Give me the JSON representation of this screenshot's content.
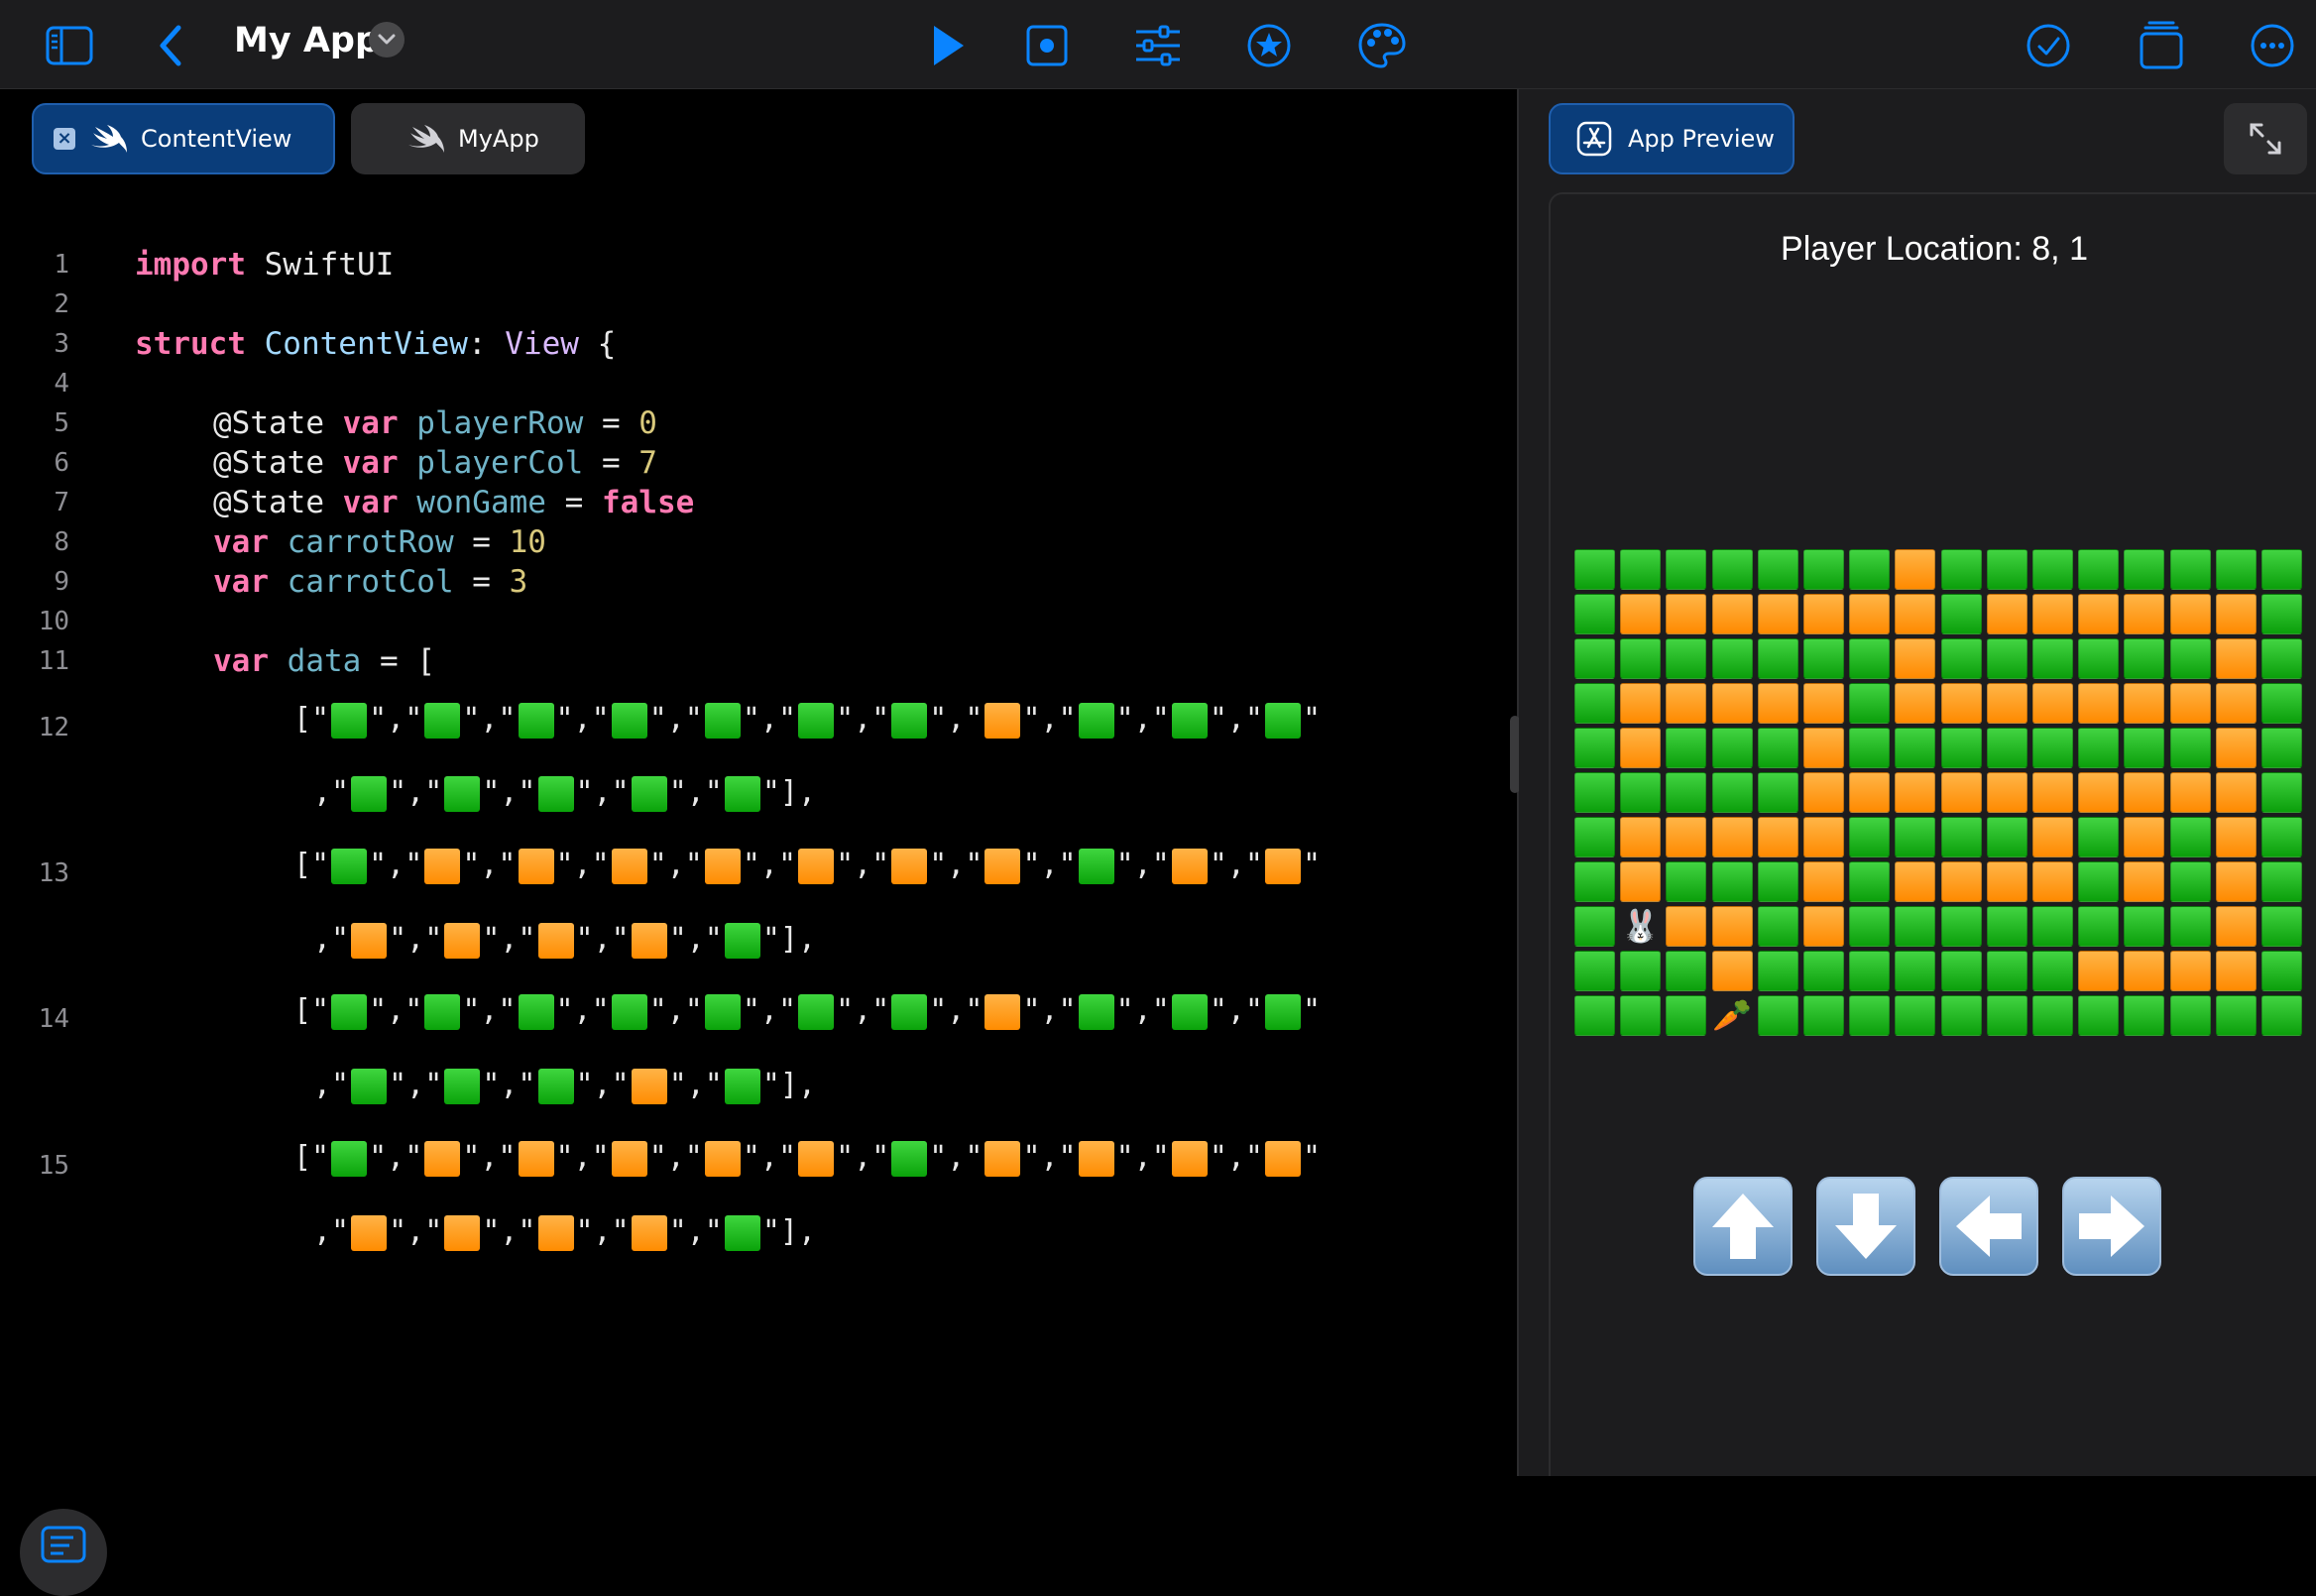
{
  "toolbar": {
    "title": "My App",
    "icons": [
      "sidebar-toggle-icon",
      "back-chevron-icon",
      "run-play-icon",
      "stop-record-icon",
      "sliders-icon",
      "star-circle-icon",
      "palette-icon",
      "checkmark-circle-icon",
      "stacked-windows-icon",
      "ellipsis-circle-icon"
    ]
  },
  "colors": {
    "accent": "#0a84ff",
    "tab_selected": "#0a3d7a",
    "emoji_green": "#1db41d",
    "emoji_orange": "#ff9500"
  },
  "editor": {
    "tabs": [
      {
        "label": "ContentView",
        "selected": true
      },
      {
        "label": "MyApp",
        "selected": false
      }
    ],
    "line_numbers": [
      "1",
      "2",
      "3",
      "4",
      "5",
      "6",
      "7",
      "8",
      "9",
      "10",
      "11",
      "12",
      "13",
      "14",
      "15"
    ],
    "code": {
      "l1_kw": "import",
      "l1_rest": " SwiftUI",
      "l3_kw": "struct",
      "l3_name": " ContentView",
      "l3_colon": ": ",
      "l3_type": "View",
      "l3_brace": " {",
      "l5_attr": "@State",
      "l5_var": " var",
      "l5_id": " playerRow",
      "l5_eq": " = ",
      "l5_val": "0",
      "l6_attr": "@State",
      "l6_var": " var",
      "l6_id": " playerCol",
      "l6_eq": " = ",
      "l6_val": "7",
      "l7_attr": "@State",
      "l7_var": " var",
      "l7_id": " wonGame",
      "l7_eq": " = ",
      "l7_val": "false",
      "l8_var": "var",
      "l8_id": " carrotRow",
      "l8_eq": " = ",
      "l8_val": "10",
      "l9_var": "var",
      "l9_id": " carrotCol",
      "l9_eq": " = ",
      "l9_val": "3",
      "l11_var": "var",
      "l11_id": " data",
      "l11_eq": " = ["
    },
    "array_rows": [
      [
        "g",
        "g",
        "g",
        "g",
        "g",
        "g",
        "g",
        "o",
        "g",
        "g",
        "g",
        "g",
        "g",
        "g",
        "g",
        "g"
      ],
      [
        "g",
        "o",
        "o",
        "o",
        "o",
        "o",
        "o",
        "o",
        "g",
        "o",
        "o",
        "o",
        "o",
        "o",
        "o",
        "g"
      ],
      [
        "g",
        "g",
        "g",
        "g",
        "g",
        "g",
        "g",
        "o",
        "g",
        "g",
        "g",
        "g",
        "g",
        "g",
        "o",
        "g"
      ],
      [
        "g",
        "o",
        "o",
        "o",
        "o",
        "o",
        "g",
        "o",
        "o",
        "o",
        "o",
        "o",
        "o",
        "o",
        "o",
        "g"
      ]
    ]
  },
  "preview": {
    "tab_label": "App Preview",
    "player_location": "Player Location: 8, 1",
    "bunny": "🐰",
    "carrot": "🥕",
    "grid": [
      [
        "g",
        "g",
        "g",
        "g",
        "g",
        "g",
        "g",
        "o",
        "g",
        "g",
        "g",
        "g",
        "g",
        "g",
        "g",
        "g"
      ],
      [
        "g",
        "o",
        "o",
        "o",
        "o",
        "o",
        "o",
        "o",
        "g",
        "o",
        "o",
        "o",
        "o",
        "o",
        "o",
        "g"
      ],
      [
        "g",
        "g",
        "g",
        "g",
        "g",
        "g",
        "g",
        "o",
        "g",
        "g",
        "g",
        "g",
        "g",
        "g",
        "o",
        "g"
      ],
      [
        "g",
        "o",
        "o",
        "o",
        "o",
        "o",
        "g",
        "o",
        "o",
        "o",
        "o",
        "o",
        "o",
        "o",
        "o",
        "g"
      ],
      [
        "g",
        "o",
        "g",
        "g",
        "g",
        "o",
        "g",
        "g",
        "g",
        "g",
        "g",
        "g",
        "g",
        "g",
        "o",
        "g"
      ],
      [
        "g",
        "g",
        "g",
        "g",
        "g",
        "o",
        "o",
        "o",
        "o",
        "o",
        "o",
        "o",
        "o",
        "o",
        "o",
        "g"
      ],
      [
        "g",
        "o",
        "o",
        "o",
        "o",
        "o",
        "g",
        "g",
        "g",
        "g",
        "o",
        "g",
        "o",
        "g",
        "o",
        "g"
      ],
      [
        "g",
        "o",
        "g",
        "g",
        "g",
        "o",
        "g",
        "o",
        "o",
        "o",
        "o",
        "g",
        "o",
        "g",
        "o",
        "g"
      ],
      [
        "g",
        "B",
        "o",
        "o",
        "g",
        "o",
        "g",
        "g",
        "g",
        "g",
        "g",
        "g",
        "g",
        "g",
        "o",
        "g"
      ],
      [
        "g",
        "g",
        "g",
        "o",
        "g",
        "g",
        "g",
        "g",
        "g",
        "g",
        "g",
        "o",
        "o",
        "o",
        "o",
        "g"
      ],
      [
        "g",
        "g",
        "g",
        "C",
        "g",
        "g",
        "g",
        "g",
        "g",
        "g",
        "g",
        "g",
        "g",
        "g",
        "g",
        "g"
      ]
    ],
    "controls": [
      "up-arrow",
      "down-arrow",
      "left-arrow",
      "right-arrow"
    ]
  }
}
